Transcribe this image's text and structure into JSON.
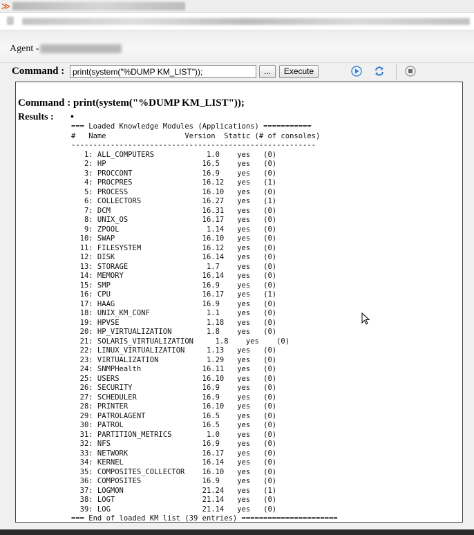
{
  "agent": {
    "label": "Agent -"
  },
  "command_bar": {
    "label": "Command :",
    "input_value": "print(system(\"%DUMP KM_LIST\"));",
    "browse_label": "...",
    "execute_label": "Execute",
    "icons": [
      "play-icon",
      "refresh-icon",
      "stop-icon"
    ]
  },
  "results": {
    "command_label": "Command : print(system(\"%DUMP KM_LIST\"));",
    "results_label": "Results :",
    "bullet": "•",
    "output_lines": [
      "=== Loaded Knowledge Modules (Applications) ===========",
      "#   Name                  Version  Static (# of consoles)",
      "--------------------------------------------------------",
      "   1: ALL_COMPUTERS            1.0    yes   (0)",
      "   2: HP                      16.5    yes   (0)",
      "   3: PROCCONT                16.9    yes   (0)",
      "   4: PROCPRES                16.12   yes   (1)",
      "   5: PROCESS                 16.10   yes   (0)",
      "   6: COLLECTORS              16.27   yes   (1)",
      "   7: DCM                     16.31   yes   (0)",
      "   8: UNIX_OS                 16.17   yes   (0)",
      "   9: ZPOOL                    1.14   yes   (0)",
      "  10: SWAP                    16.10   yes   (0)",
      "  11: FILESYSTEM              16.12   yes   (0)",
      "  12: DISK                    16.14   yes   (0)",
      "  13: STORAGE                  1.7    yes   (0)",
      "  14: MEMORY                  16.14   yes   (0)",
      "  15: SMP                     16.9    yes   (0)",
      "  16: CPU                     16.17   yes   (1)",
      "  17: HAAG                    16.9    yes   (0)",
      "  18: UNIX_KM_CONF             1.1    yes   (0)",
      "  19: HPVSE                    1.18   yes   (0)",
      "  20: HP_VIRTUALIZATION        1.8    yes   (0)",
      "  21: SOLARIS_VIRTUALIZATION     1.8    yes    (0)",
      "  22: LINUX_VIRTUALIZATION     1.13   yes   (0)",
      "  23: VIRTUALIZATION           1.29   yes   (0)",
      "  24: SNMPHealth              16.11   yes   (0)",
      "  25: USERS                   16.10   yes   (0)",
      "  26: SECURITY                16.9    yes   (0)",
      "  27: SCHEDULER               16.9    yes   (0)",
      "  28: PRINTER                 16.10   yes   (0)",
      "  29: PATROLAGENT             16.5    yes   (0)",
      "  30: PATROL                  16.5    yes   (0)",
      "  31: PARTITION_METRICS        1.0    yes   (0)",
      "  32: NFS                     16.9    yes   (0)",
      "  33: NETWORK                 16.17   yes   (0)",
      "  34: KERNEL                  16.14   yes   (0)",
      "  35: COMPOSITES_COLLECTOR    16.10   yes   (0)",
      "  36: COMPOSITES              16.9    yes   (0)",
      "  37: LOGMON                  21.24   yes   (1)",
      "  38: LOGT                    21.14   yes   (0)",
      "  39: LOG                     21.14   yes   (0)",
      "=== End of loaded KM list (39 entries) ======================"
    ]
  },
  "colors": {
    "icon_blue": "#2a7bd1",
    "panel_border": "#444444"
  }
}
